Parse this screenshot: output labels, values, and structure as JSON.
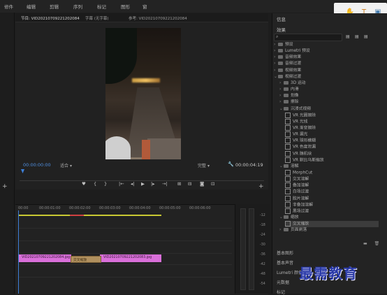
{
  "menubar": {
    "items": [
      "修件",
      "编辑",
      "剪辑",
      "序列",
      "标记",
      "图形",
      "窗"
    ]
  },
  "monitor": {
    "tabs": [
      "节目: VID20210709221202084",
      "字幕 (无字幕)",
      "参考: VID20210709221202084"
    ],
    "timecode_current": "00:00:00:00",
    "fit_value": "适合",
    "quality_value": "完整",
    "timecode_duration": "00:00:04:19"
  },
  "effects_panel": {
    "info_title": "信息",
    "title": "效果",
    "tree": [
      {
        "label": "预设",
        "level": 0,
        "type": "folder",
        "expanded": false
      },
      {
        "label": "Lumetri 预设",
        "level": 0,
        "type": "folder",
        "expanded": false
      },
      {
        "label": "音频效果",
        "level": 0,
        "type": "folder",
        "expanded": false
      },
      {
        "label": "音频过渡",
        "level": 0,
        "type": "folder",
        "expanded": false
      },
      {
        "label": "视频效果",
        "level": 0,
        "type": "folder",
        "expanded": false
      },
      {
        "label": "视频过渡",
        "level": 0,
        "type": "folder",
        "expanded": true
      },
      {
        "label": "3D 运动",
        "level": 1,
        "type": "folder",
        "expanded": false
      },
      {
        "label": "内滑",
        "level": 1,
        "type": "folder",
        "expanded": false
      },
      {
        "label": "划像",
        "level": 1,
        "type": "folder",
        "expanded": false
      },
      {
        "label": "擦除",
        "level": 1,
        "type": "folder",
        "expanded": false
      },
      {
        "label": "沉浸式视频",
        "level": 1,
        "type": "folder",
        "expanded": true
      },
      {
        "label": "VR 光圈擦除",
        "level": 2,
        "type": "fx"
      },
      {
        "label": "VR 光线",
        "level": 2,
        "type": "fx"
      },
      {
        "label": "VR 渐变擦除",
        "level": 2,
        "type": "fx"
      },
      {
        "label": "VR 漏光",
        "level": 2,
        "type": "fx"
      },
      {
        "label": "VR 球形模糊",
        "level": 2,
        "type": "fx"
      },
      {
        "label": "VR 色度泄漏",
        "level": 2,
        "type": "fx"
      },
      {
        "label": "VR 随机块",
        "level": 2,
        "type": "fx"
      },
      {
        "label": "VR 默比乌斯缩放",
        "level": 2,
        "type": "fx"
      },
      {
        "label": "溶解",
        "level": 1,
        "type": "folder",
        "expanded": true
      },
      {
        "label": "MorphCut",
        "level": 2,
        "type": "fx"
      },
      {
        "label": "交叉溶解",
        "level": 2,
        "type": "fx"
      },
      {
        "label": "叠加溶解",
        "level": 2,
        "type": "fx"
      },
      {
        "label": "白场过渡",
        "level": 2,
        "type": "fx"
      },
      {
        "label": "胶片溶解",
        "level": 2,
        "type": "fx"
      },
      {
        "label": "非叠加溶解",
        "level": 2,
        "type": "fx"
      },
      {
        "label": "黑场过渡",
        "level": 2,
        "type": "fx"
      },
      {
        "label": "缩放",
        "level": 1,
        "type": "folder",
        "expanded": true
      },
      {
        "label": "交叉缩放",
        "level": 2,
        "type": "fx",
        "selected": true
      },
      {
        "label": "页面剥落",
        "level": 1,
        "type": "folder",
        "expanded": false
      }
    ],
    "bottom_panels": [
      "基本图形",
      "基本声音",
      "Lumetri 颜色",
      "元数据",
      "标记"
    ]
  },
  "timeline": {
    "ruler_labels": [
      "00:00",
      "00:00:01:00",
      "00:00:02:00",
      "00:00:03:00",
      "00:00:04:00",
      "00:00:05:00",
      "00:00:06:00"
    ],
    "clip_a_label": "VID20210709221202084.jpg",
    "transition_label": "交叉缩放",
    "clip_b_label": "VID20210709221202083.jpg"
  },
  "meters": {
    "db_labels": [
      "-12",
      "-18",
      "-24",
      "-30",
      "-36",
      "-42",
      "-48",
      "-54"
    ]
  },
  "watermark": "最需教育"
}
